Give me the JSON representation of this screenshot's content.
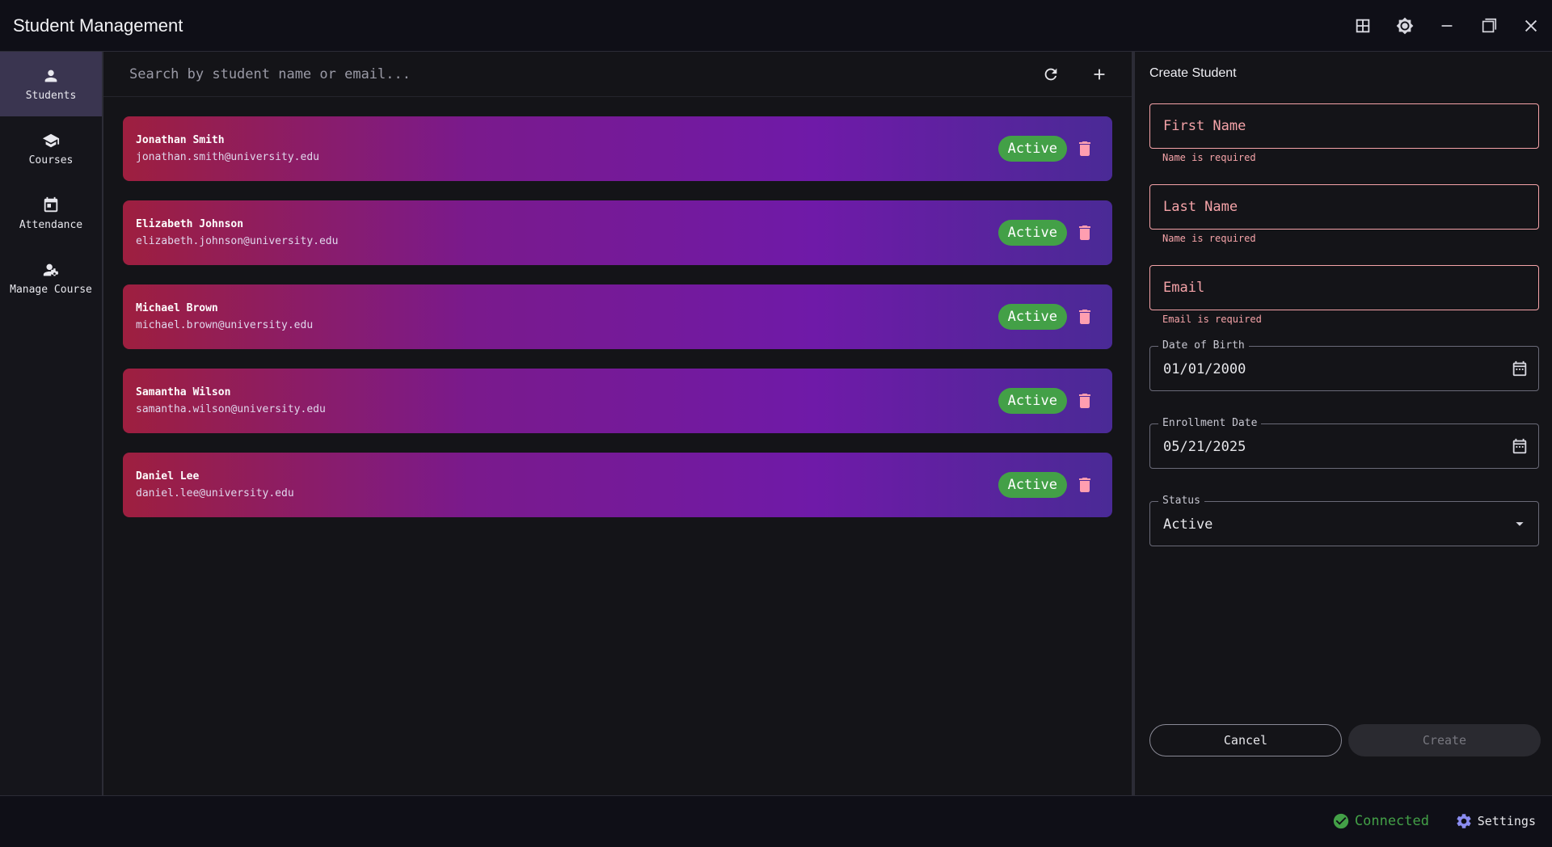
{
  "window": {
    "title": "Student Management",
    "controls": [
      "dashboard-icon",
      "brightness-icon",
      "minimize-icon",
      "maximize-icon",
      "close-icon"
    ]
  },
  "sidebar": {
    "items": [
      {
        "label": "Students",
        "icon": "person-icon",
        "active": true
      },
      {
        "label": "Courses",
        "icon": "school-icon",
        "active": false
      },
      {
        "label": "Attendance",
        "icon": "calendar-icon",
        "active": false
      },
      {
        "label": "Manage Course",
        "icon": "manage-accounts-icon",
        "active": false
      }
    ]
  },
  "search": {
    "placeholder": "Search by student name or email..."
  },
  "students": [
    {
      "name": "Jonathan Smith",
      "email": "jonathan.smith@university.edu",
      "status": "Active"
    },
    {
      "name": "Elizabeth Johnson",
      "email": "elizabeth.johnson@university.edu",
      "status": "Active"
    },
    {
      "name": "Michael Brown",
      "email": "michael.brown@university.edu",
      "status": "Active"
    },
    {
      "name": "Samantha Wilson",
      "email": "samantha.wilson@university.edu",
      "status": "Active"
    },
    {
      "name": "Daniel Lee",
      "email": "daniel.lee@university.edu",
      "status": "Active"
    }
  ],
  "form": {
    "title": "Create Student",
    "first_name": {
      "placeholder": "First Name",
      "error": "Name is required"
    },
    "last_name": {
      "placeholder": "Last Name",
      "error": "Name is required"
    },
    "email": {
      "placeholder": "Email",
      "error": "Email is required"
    },
    "dob": {
      "label": "Date of Birth",
      "value": "01/01/2000"
    },
    "enrollment": {
      "label": "Enrollment Date",
      "value": "05/21/2025"
    },
    "status": {
      "label": "Status",
      "value": "Active"
    },
    "cancel_label": "Cancel",
    "create_label": "Create"
  },
  "statusbar": {
    "connection": "Connected",
    "settings": "Settings"
  },
  "colors": {
    "accent": "#43a047",
    "error": "#f5a3a8",
    "card_gradient_start": "#9e1f3f",
    "card_gradient_end": "#4a2a96"
  }
}
